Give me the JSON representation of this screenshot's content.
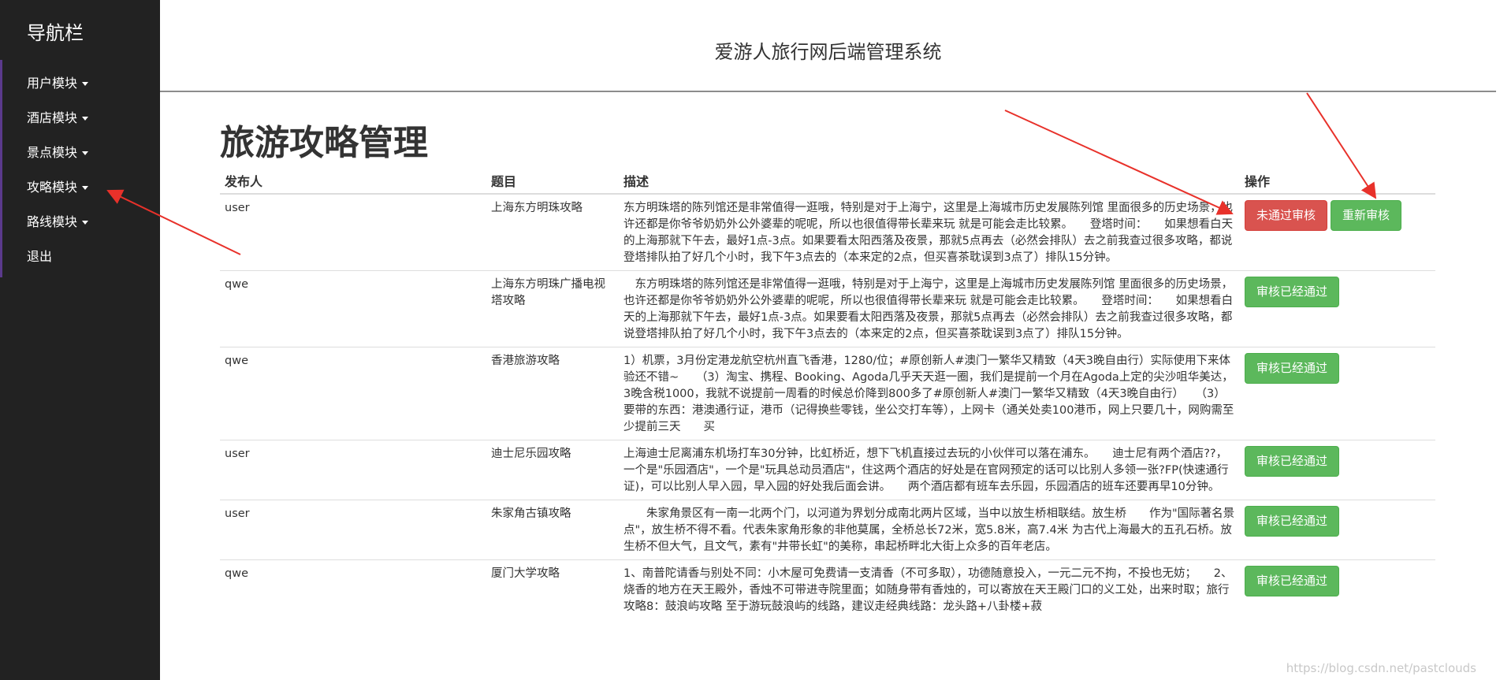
{
  "sidebar": {
    "brand": "导航栏",
    "items": [
      {
        "label": "用户模块",
        "dropdown": true
      },
      {
        "label": "酒店模块",
        "dropdown": true
      },
      {
        "label": "景点模块",
        "dropdown": true
      },
      {
        "label": "攻略模块",
        "dropdown": true
      },
      {
        "label": "路线模块",
        "dropdown": true
      },
      {
        "label": "退出",
        "dropdown": false
      }
    ]
  },
  "header": {
    "title": "爱游人旅行网后端管理系统"
  },
  "main": {
    "page_title": "旅游攻略管理",
    "columns": [
      "发布人",
      "题目",
      "描述",
      "操作"
    ],
    "rows": [
      {
        "author": "user",
        "title": "上海东方明珠攻略",
        "desc": "东方明珠塔的陈列馆还是非常值得一逛哦，特别是对于上海宁，这里是上海城市历史发展陈列馆 里面很多的历史场景，也许还都是你爷爷奶奶外公外婆辈的呢呢，所以也很值得带长辈来玩 就是可能会走比较累。　　登塔时间：　　如果想看白天的上海那就下午去，最好1点-3点。如果要看太阳西落及夜景，那就5点再去（必然会排队）去之前我查过很多攻略，都说登塔排队拍了好几个小时，我下午3点去的（本来定的2点，但买喜茶耽误到3点了）排队15分钟。",
        "buttons": [
          {
            "label": "未通过审核",
            "style": "danger"
          },
          {
            "label": "重新审核",
            "style": "success"
          }
        ]
      },
      {
        "author": "qwe",
        "title": "上海东方明珠广播电视塔攻略",
        "desc": "　东方明珠塔的陈列馆还是非常值得一逛哦，特别是对于上海宁，这里是上海城市历史发展陈列馆 里面很多的历史场景，也许还都是你爷爷奶奶外公外婆辈的呢呢，所以也很值得带长辈来玩 就是可能会走比较累。　　登塔时间：　　如果想看白天的上海那就下午去，最好1点-3点。如果要看太阳西落及夜景，那就5点再去（必然会排队）去之前我查过很多攻略，都说登塔排队拍了好几个小时，我下午3点去的（本来定的2点，但买喜茶耽误到3点了）排队15分钟。",
        "buttons": [
          {
            "label": "审核已经通过",
            "style": "success"
          }
        ]
      },
      {
        "author": "qwe",
        "title": "香港旅游攻略",
        "desc": "1）机票，3月份定港龙航空杭州直飞香港，1280/位；#原创新人#澳门一繁华又精致（4天3晚自由行）实际使用下来体验还不错~　　（3）淘宝、携程、Booking、Agoda几乎天天逛一圈，我们是提前一个月在Agoda上定的尖沙咀华美达，3晚含税1000，我就不说提前一周看的时候总价降到800多了#原创新人#澳门一繁华又精致（4天3晚自由行）　　（3）要带的东西：港澳通行证，港币（记得换些零钱，坐公交打车等），上网卡（通关处卖100港币，网上只要几十，网购需至少提前三天　　买",
        "buttons": [
          {
            "label": "审核已经通过",
            "style": "success"
          }
        ]
      },
      {
        "author": "user",
        "title": "迪士尼乐园攻略",
        "desc": "上海迪士尼离浦东机场打车30分钟，比虹桥近，想下飞机直接过去玩的小伙伴可以落在浦东。　　迪士尼有两个酒店??，一个是\"乐园酒店\"，一个是\"玩具总动员酒店\"，住这两个酒店的好处是在官网预定的话可以比别人多领一张?FP(快速通行证)，可以比别人早入园，早入园的好处我后面会讲。　　两个酒店都有班车去乐园，乐园酒店的班车还要再早10分钟。",
        "buttons": [
          {
            "label": "审核已经通过",
            "style": "success"
          }
        ]
      },
      {
        "author": "user",
        "title": "朱家角古镇攻略",
        "desc": "　　朱家角景区有一南一北两个门，以河道为界划分成南北两片区域，当中以放生桥相联结。放生桥　　作为\"国际著名景点\"，放生桥不得不看。代表朱家角形象的非他莫属，全桥总长72米，宽5.8米，高7.4米 为古代上海最大的五孔石桥。放生桥不但大气，且文气，素有\"井带长虹\"的美称，串起桥畔北大街上众多的百年老店。",
        "buttons": [
          {
            "label": "审核已经通过",
            "style": "success"
          }
        ]
      },
      {
        "author": "qwe",
        "title": "厦门大学攻略",
        "desc": "1、南普陀请香与别处不同：小木屋可免费请一支清香（不可多取），功德随意投入，一元二元不拘，不投也无妨；　　2、烧香的地方在天王殿外，香烛不可带进寺院里面；如随身带有香烛的，可以寄放在天王殿门口的义工处，出来时取；旅行攻略8：鼓浪屿攻略 至于游玩鼓浪屿的线路，建议走经典线路：龙头路+八卦楼+菽",
        "buttons": [
          {
            "label": "审核已经通过",
            "style": "success"
          }
        ]
      }
    ]
  },
  "watermark": "https://blog.csdn.net/pastclouds"
}
